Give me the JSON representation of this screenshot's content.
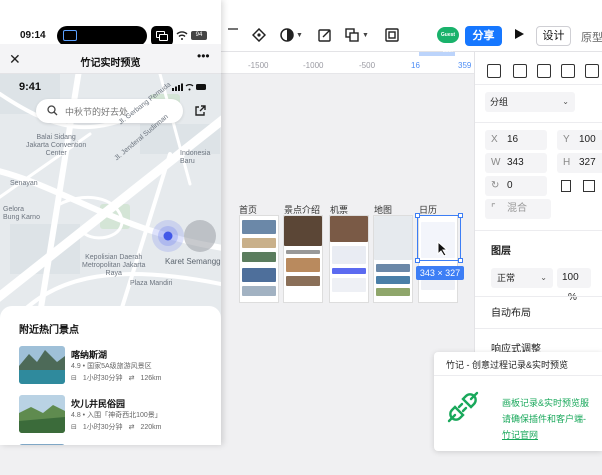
{
  "phone_window": {
    "host_status": {
      "time": "09:14",
      "battery": "94"
    },
    "mini_program": {
      "title": "竹记实时预览",
      "close_glyph": "✕",
      "more_glyph": "•••"
    },
    "inner_status": {
      "time": "9:41"
    },
    "search": {
      "placeholder": "中秋节的好去处"
    },
    "map_labels": {
      "convention": "Balai Sidang\nJakarta Convention\nCenter",
      "street1": "Jl. Jenderal Sudirman",
      "street2": "Jl. Gerbang Pemuda",
      "senayan": "Senayan",
      "council": "Kepolisian Daerah\nMetropolitan Jakarta\nRaya",
      "mandiri": "Plaza Mandiri",
      "semanggi": "Karet Semanggi",
      "indonesia": "Indonesia\nBaru",
      "gelora": "Gelora\nBung Karno"
    },
    "sheet": {
      "title": "附近热门景点",
      "spots": [
        {
          "name": "喀纳斯湖",
          "meta": "4.9 • 国家5A级旅游风景区",
          "time": "1小时30分钟",
          "distance": "126km"
        },
        {
          "name": "坎儿井民俗园",
          "meta": "4.8 • 入围「神奇西北100景」",
          "time": "1小时30分钟",
          "distance": "220km"
        }
      ]
    }
  },
  "toolbar": {
    "avatar_label": "Guest user",
    "share_label": "分享",
    "design_tab": "设计",
    "prototype_tab": "原型"
  },
  "ruler": {
    "ticks": [
      "-1500",
      "-1000",
      "-500",
      "16",
      "359"
    ]
  },
  "canvas": {
    "frames": [
      "首页",
      "景点介绍",
      "机票",
      "地图",
      "日历"
    ],
    "selection_size": "343 × 327"
  },
  "right_panel": {
    "group_label": "分组",
    "x": "16",
    "y": "100",
    "w": "343",
    "h": "327",
    "rotation": "0",
    "corner_placeholder": "混合",
    "layer_title": "图层",
    "blend_mode": "正常",
    "opacity": "100",
    "opacity_unit": "%",
    "auto_layout": "自动布局",
    "responsive": "响应式调整"
  },
  "notification": {
    "title": "竹记 - 创意过程记录&实时预览",
    "line1": "画板记录&实时预览服",
    "line2": "请确保插件和客户端-",
    "link": "竹记官网"
  },
  "colors": {
    "accent": "#1677ff",
    "selection": "#3d7ef5",
    "notify_green": "#19a85b",
    "map_road": "#ffffff",
    "map_bg": "#e8ecef"
  }
}
